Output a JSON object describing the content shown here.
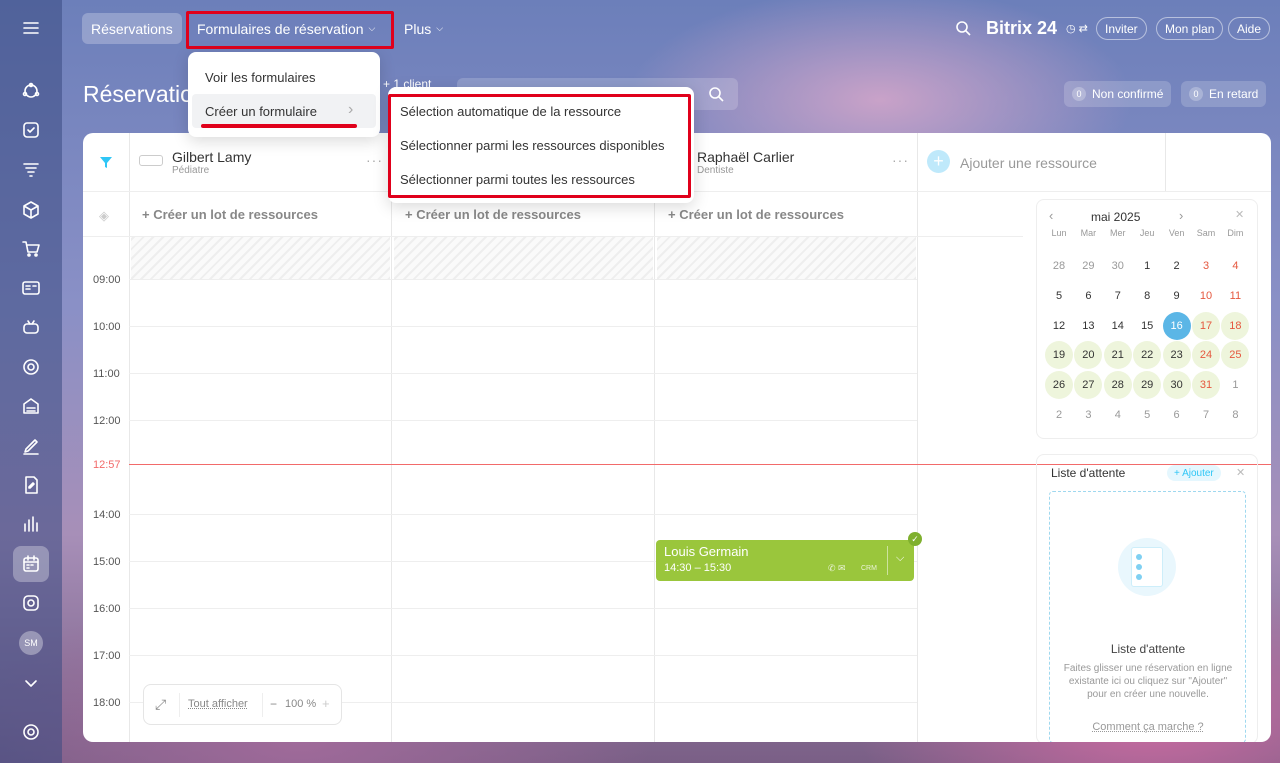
{
  "sidebar": {
    "avatar": "SM"
  },
  "topbar": {
    "tab_reservations": "Réservations",
    "tab_forms": "Formulaires de réservation",
    "tab_more": "Plus",
    "brand": "Bitrix 24",
    "invite": "Inviter",
    "plan": "Mon plan",
    "help": "Aide"
  },
  "page": {
    "title": "Réservations",
    "client": "+ 1 client"
  },
  "badges": {
    "unconfirmed_count": "0",
    "unconfirmed": "Non confirmé",
    "late_count": "0",
    "late": "En retard"
  },
  "dropdown": {
    "view_forms": "Voir les formulaires",
    "create_form": "Créer un formulaire"
  },
  "submenu": {
    "auto": "Sélection automatique de la ressource",
    "available": "Sélectionner parmi les ressources disponibles",
    "all": "Sélectionner parmi toutes les ressources"
  },
  "resources": [
    {
      "name": "Gilbert Lamy",
      "role": "Pédiatre"
    },
    {
      "name": "Raphaël Carlier",
      "role": "Dentiste"
    }
  ],
  "add_resource": "Ajouter une ressource",
  "create_lot": "+ Créer un lot de ressources",
  "times": [
    "09:00",
    "10:00",
    "11:00",
    "12:00",
    "12:57",
    "14:00",
    "15:00",
    "16:00",
    "17:00",
    "18:00"
  ],
  "event": {
    "name": "Louis Germain",
    "time": "14:30 – 15:30",
    "crm": "CRM"
  },
  "calendar": {
    "month": "mai 2025",
    "weekdays": [
      "Lun",
      "Mar",
      "Mer",
      "Jeu",
      "Ven",
      "Sam",
      "Dim"
    ],
    "weeks": [
      [
        "28",
        "29",
        "30",
        "1",
        "2",
        "3",
        "4"
      ],
      [
        "5",
        "6",
        "7",
        "8",
        "9",
        "10",
        "11"
      ],
      [
        "12",
        "13",
        "14",
        "15",
        "16",
        "17",
        "18"
      ],
      [
        "19",
        "20",
        "21",
        "22",
        "23",
        "24",
        "25"
      ],
      [
        "26",
        "27",
        "28",
        "29",
        "30",
        "31",
        "1"
      ],
      [
        "2",
        "3",
        "4",
        "5",
        "6",
        "7",
        "8"
      ]
    ]
  },
  "waitlist": {
    "title": "Liste d'attente",
    "add": "+ Ajouter",
    "empty_title": "Liste d'attente",
    "empty_text": "Faites glisser une réservation en ligne existante ici ou cliquez sur \"Ajouter\" pour en créer une nouvelle.",
    "link": "Comment ça marche ?"
  },
  "zoom": {
    "show_all": "Tout afficher",
    "level": "100 %"
  },
  "colors": {
    "accent": "#2fc6f6",
    "event": "#9ac63c",
    "now_line": "#f26a6a",
    "highlight": "#e0001b"
  }
}
